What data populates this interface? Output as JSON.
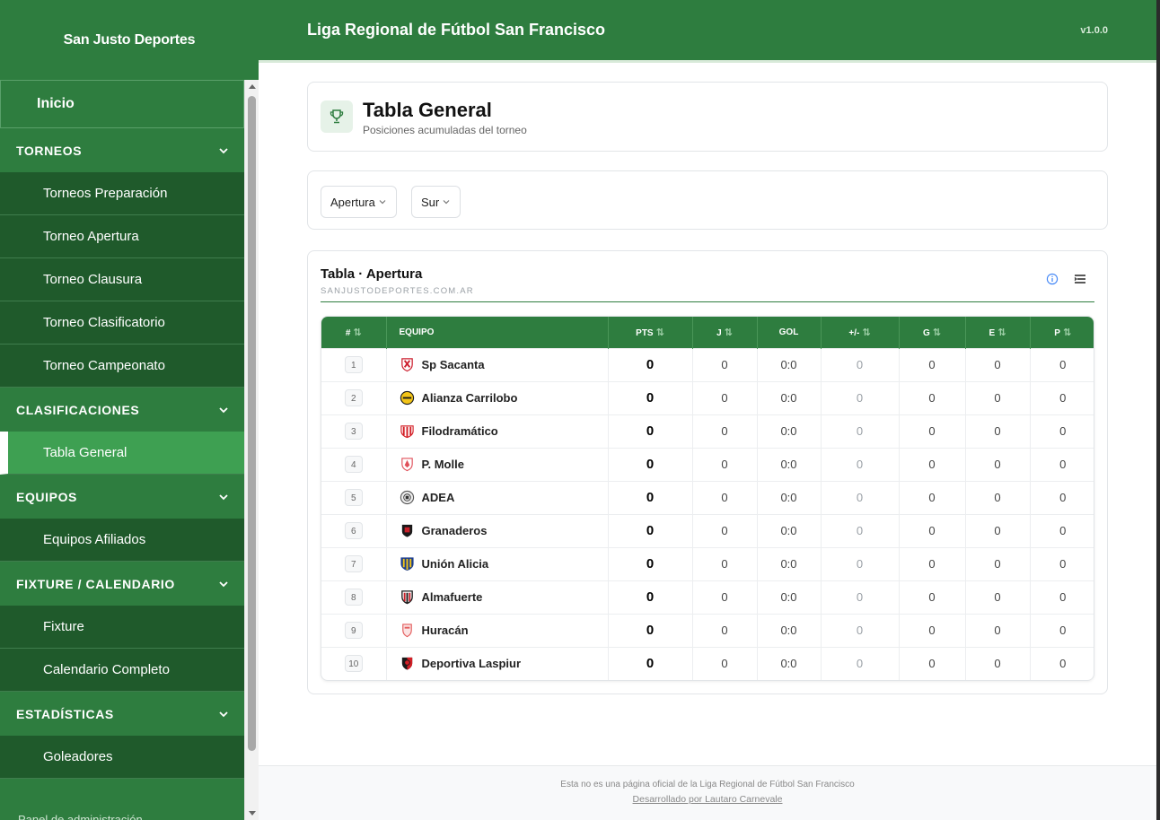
{
  "sidebar": {
    "brand": "San Justo Deportes",
    "home": "Inicio",
    "sections": {
      "torneos": {
        "label": "TORNEOS",
        "items": [
          "Torneos Preparación",
          "Torneo Apertura",
          "Torneo Clausura",
          "Torneo Clasificatorio",
          "Torneo Campeonato"
        ]
      },
      "clasificaciones": {
        "label": "CLASIFICACIONES",
        "items": [
          "Tabla General"
        ]
      },
      "equipos": {
        "label": "EQUIPOS",
        "items": [
          "Equipos Afiliados"
        ]
      },
      "fixture": {
        "label": "FIXTURE / CALENDARIO",
        "items": [
          "Fixture",
          "Calendario Completo"
        ]
      },
      "estadisticas": {
        "label": "ESTADÍSTICAS",
        "items": [
          "Goleadores"
        ]
      }
    },
    "admin": "Panel de administración"
  },
  "topbar": {
    "title": "Liga Regional de Fútbol San Francisco",
    "version": "v1.0.0"
  },
  "header": {
    "title": "Tabla General",
    "subtitle": "Posiciones acumuladas del torneo"
  },
  "filters": {
    "tournament": "Apertura",
    "zone": "Sur"
  },
  "table": {
    "title": "Tabla · Apertura",
    "site": "SANJUSTODEPORTES.COM.AR",
    "columns": {
      "pos": "#",
      "team": "EQUIPO",
      "pts": "PTS",
      "j": "J",
      "gol": "GOL",
      "diff": "+/-",
      "g": "G",
      "e": "E",
      "p": "P"
    },
    "rows": [
      {
        "pos": "1",
        "team": "Sp Sacanta",
        "pts": "0",
        "j": "0",
        "gol": "0:0",
        "diff": "0",
        "g": "0",
        "e": "0",
        "p": "0"
      },
      {
        "pos": "2",
        "team": "Alianza Carrilobo",
        "pts": "0",
        "j": "0",
        "gol": "0:0",
        "diff": "0",
        "g": "0",
        "e": "0",
        "p": "0"
      },
      {
        "pos": "3",
        "team": "Filodramático",
        "pts": "0",
        "j": "0",
        "gol": "0:0",
        "diff": "0",
        "g": "0",
        "e": "0",
        "p": "0"
      },
      {
        "pos": "4",
        "team": "P. Molle",
        "pts": "0",
        "j": "0",
        "gol": "0:0",
        "diff": "0",
        "g": "0",
        "e": "0",
        "p": "0"
      },
      {
        "pos": "5",
        "team": "ADEA",
        "pts": "0",
        "j": "0",
        "gol": "0:0",
        "diff": "0",
        "g": "0",
        "e": "0",
        "p": "0"
      },
      {
        "pos": "6",
        "team": "Granaderos",
        "pts": "0",
        "j": "0",
        "gol": "0:0",
        "diff": "0",
        "g": "0",
        "e": "0",
        "p": "0"
      },
      {
        "pos": "7",
        "team": "Unión Alicia",
        "pts": "0",
        "j": "0",
        "gol": "0:0",
        "diff": "0",
        "g": "0",
        "e": "0",
        "p": "0"
      },
      {
        "pos": "8",
        "team": "Almafuerte",
        "pts": "0",
        "j": "0",
        "gol": "0:0",
        "diff": "0",
        "g": "0",
        "e": "0",
        "p": "0"
      },
      {
        "pos": "9",
        "team": "Huracán",
        "pts": "0",
        "j": "0",
        "gol": "0:0",
        "diff": "0",
        "g": "0",
        "e": "0",
        "p": "0"
      },
      {
        "pos": "10",
        "team": "Deportiva Laspiur",
        "pts": "0",
        "j": "0",
        "gol": "0:0",
        "diff": "0",
        "g": "0",
        "e": "0",
        "p": "0"
      }
    ]
  },
  "footer": {
    "note": "Esta no es una página oficial de la Liga Regional de Fútbol San Francisco",
    "credit": "Desarrollado por Lautaro Carnevale"
  },
  "colors": {
    "primary": "#2e7d3f",
    "dark": "#1f5a2b",
    "active": "#3ea052"
  }
}
